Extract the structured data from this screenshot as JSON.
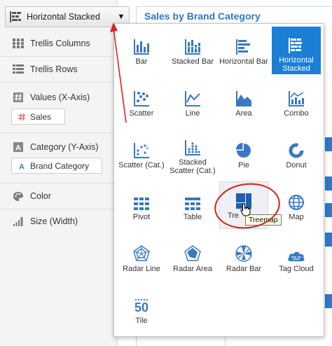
{
  "left_panel": {
    "chart_type": {
      "label": "Horizontal Stacked",
      "icon": "horizontal-stacked-icon",
      "caret": "▼"
    },
    "rows": [
      {
        "key": "trellis_columns",
        "label": "Trellis Columns",
        "icon": "trellis-columns-icon"
      },
      {
        "key": "trellis_rows",
        "label": "Trellis Rows",
        "icon": "trellis-rows-icon"
      },
      {
        "key": "values",
        "label": "Values (X-Axis)",
        "icon": "hash-icon"
      },
      {
        "key": "category",
        "label": "Category (Y-Axis)",
        "icon": "text-a-icon"
      },
      {
        "key": "color",
        "label": "Color",
        "icon": "palette-icon"
      },
      {
        "key": "size",
        "label": "Size (Width)",
        "icon": "size-icon"
      }
    ],
    "pills": [
      {
        "label": "Sales",
        "icon": "hash-icon"
      },
      {
        "label": "Brand Category",
        "icon": "text-a-icon"
      }
    ]
  },
  "chart_title": "Sales by Brand Category",
  "popup": {
    "tiles": [
      {
        "label": "Bar",
        "icon": "bar-chart-icon"
      },
      {
        "label": "Stacked Bar",
        "icon": "stacked-bar-icon"
      },
      {
        "label": "Horizontal Bar",
        "icon": "horizontal-bar-icon"
      },
      {
        "label": "Horizontal Stacked",
        "icon": "horizontal-stacked-icon",
        "selected": true
      },
      {
        "label": "Scatter",
        "icon": "scatter-icon"
      },
      {
        "label": "Line",
        "icon": "line-chart-icon"
      },
      {
        "label": "Area",
        "icon": "area-chart-icon"
      },
      {
        "label": "Combo",
        "icon": "combo-chart-icon"
      },
      {
        "label": "Scatter (Cat.)",
        "icon": "scatter-cat-icon"
      },
      {
        "label": "Stacked Scatter (Cat.)",
        "icon": "stacked-scatter-icon"
      },
      {
        "label": "Pie",
        "icon": "pie-icon"
      },
      {
        "label": "Donut",
        "icon": "donut-icon"
      },
      {
        "label": "Pivot",
        "icon": "pivot-icon"
      },
      {
        "label": "Table",
        "icon": "table-icon"
      },
      {
        "label": "Tre",
        "icon": "treemap-icon",
        "hovered": true
      },
      {
        "label": "Map",
        "icon": "globe-icon"
      },
      {
        "label": "Radar Line",
        "icon": "radar-line-icon"
      },
      {
        "label": "Radar Area",
        "icon": "radar-area-icon"
      },
      {
        "label": "Radar Bar",
        "icon": "radar-bar-icon"
      },
      {
        "label": "Tag Cloud",
        "icon": "tag-cloud-icon"
      },
      {
        "label": "Tile",
        "icon": "tile-50-icon",
        "glyph": "50"
      }
    ],
    "tooltip": "Treemap"
  },
  "colors": {
    "accent": "#1b7fd6",
    "title": "#2b79c7",
    "annotation": "#e02020"
  }
}
